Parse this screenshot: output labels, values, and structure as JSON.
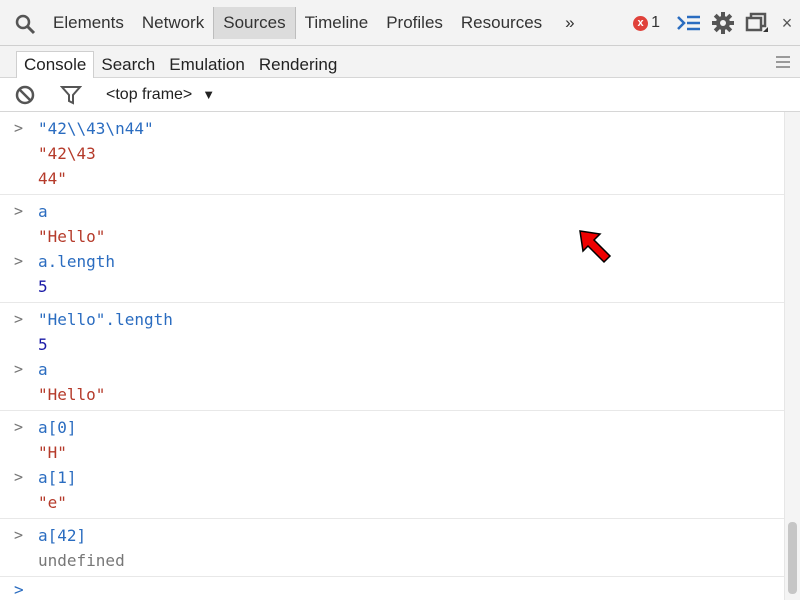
{
  "toolbar": {
    "tabs": [
      "Elements",
      "Network",
      "Sources",
      "Timeline",
      "Profiles",
      "Resources"
    ],
    "more": "»",
    "error_count": "1",
    "error_icon": "x",
    "close": "×"
  },
  "subtabs": [
    "Console",
    "Search",
    "Emulation",
    "Rendering"
  ],
  "filter": {
    "context": "<top frame>",
    "arrow": "▼"
  },
  "console": [
    {
      "input": "\"42\\\\43\\n44\"",
      "output": [
        "\"42\\43",
        "44\""
      ],
      "type": "str"
    },
    {
      "input": "a",
      "output": [
        "\"Hello\""
      ],
      "type": "str"
    },
    {
      "input": "a.length",
      "output": [
        "5"
      ],
      "type": "num"
    },
    {
      "input": "\"Hello\".length",
      "output": [
        "5"
      ],
      "type": "num"
    },
    {
      "input": "a",
      "output": [
        "\"Hello\""
      ],
      "type": "str"
    },
    {
      "input": "a[0]",
      "output": [
        "\"H\""
      ],
      "type": "str"
    },
    {
      "input": "a[1]",
      "output": [
        "\"e\""
      ],
      "type": "str"
    },
    {
      "input": "a[42]",
      "output": [
        "undefined"
      ],
      "type": "undef"
    }
  ],
  "prompt_symbol": ">",
  "colors": {
    "accent": "#2a6cc0",
    "string": "#b53a2a",
    "number": "#1a1aa6",
    "error": "#e0413a",
    "pointer": "#ee0000"
  }
}
